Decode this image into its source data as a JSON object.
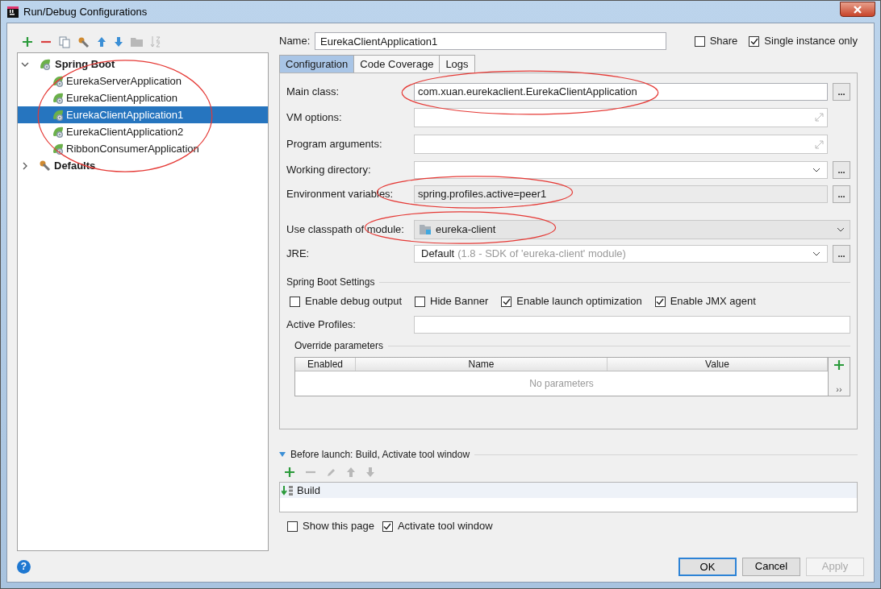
{
  "window": {
    "title": "Run/Debug Configurations"
  },
  "toolbar": [
    {
      "kind": "add",
      "disabled": false
    },
    {
      "kind": "remove",
      "disabled": false
    },
    {
      "kind": "copy",
      "disabled": false
    },
    {
      "kind": "wrench",
      "disabled": false
    },
    {
      "kind": "up",
      "disabled": false
    },
    {
      "kind": "down",
      "disabled": false
    },
    {
      "kind": "folder",
      "disabled": true
    },
    {
      "kind": "sort",
      "disabled": true
    }
  ],
  "tree": {
    "circled": true,
    "items": [
      {
        "label": "Spring Boot",
        "kind": "group",
        "expanded": true,
        "selected": false,
        "children": [
          {
            "label": "EurekaServerApplication",
            "kind": "config",
            "selected": false
          },
          {
            "label": "EurekaClientApplication",
            "kind": "config",
            "selected": false
          },
          {
            "label": "EurekaClientApplication1",
            "kind": "config",
            "selected": true
          },
          {
            "label": "EurekaClientApplication2",
            "kind": "config",
            "selected": false
          },
          {
            "label": "RibbonConsumerApplication",
            "kind": "config",
            "selected": false
          }
        ]
      },
      {
        "label": "Defaults",
        "kind": "defaults",
        "expanded": false,
        "selected": false
      }
    ]
  },
  "name": {
    "label": "Name:",
    "value": "EurekaClientApplication1"
  },
  "options": [
    {
      "label": "Share",
      "checked": false
    },
    {
      "label": "Single instance only",
      "checked": true
    }
  ],
  "tabs": [
    {
      "label": "Configuration",
      "selected": true
    },
    {
      "label": "Code Coverage",
      "selected": false
    },
    {
      "label": "Logs",
      "selected": false
    }
  ],
  "fields": [
    {
      "kind": "text",
      "label": "Main class:",
      "value": "com.xuan.eurekaclient.EurekaClientApplication",
      "browse": "...",
      "circled": true,
      "readonly": false
    },
    {
      "kind": "expand",
      "label": "VM options:"
    },
    {
      "kind": "expand",
      "label": "Program arguments:"
    },
    {
      "kind": "combo",
      "label": "Working directory:",
      "browse": "..."
    },
    {
      "kind": "text",
      "label": "Environment variables:",
      "value": "spring.profiles.active=peer1",
      "browse": "...",
      "circled": true,
      "readonly": true
    },
    {
      "kind": "module",
      "label": "Use classpath of module:",
      "value": "eureka-client",
      "circled": true
    },
    {
      "kind": "jre",
      "label": "JRE:",
      "value": "Default",
      "hint": "(1.8 - SDK of 'eureka-client' module)",
      "browse": "..."
    }
  ],
  "spring_boot_settings": {
    "title": "Spring Boot Settings",
    "checkboxes": [
      {
        "label": "Enable debug output",
        "checked": false
      },
      {
        "label": "Hide Banner",
        "checked": false
      },
      {
        "label": "Enable launch optimization",
        "checked": true
      },
      {
        "label": "Enable JMX agent",
        "checked": true
      }
    ],
    "active_profiles": {
      "label": "Active Profiles:"
    }
  },
  "override_parameters": {
    "title": "Override parameters",
    "columns": [
      "Enabled",
      "Name",
      "Value"
    ],
    "empty_text": "No parameters",
    "more": "››"
  },
  "before_launch": {
    "title": "Before launch: Build, Activate tool window",
    "expanded": true,
    "toolbar": [
      {
        "kind": "add",
        "disabled": false
      },
      {
        "kind": "remove",
        "disabled": true
      },
      {
        "kind": "edit",
        "disabled": true
      },
      {
        "kind": "up",
        "disabled": true
      },
      {
        "kind": "down",
        "disabled": true
      }
    ],
    "tasks": [
      {
        "label": "Build",
        "selected": true
      }
    ],
    "checkboxes": [
      {
        "label": "Show this page",
        "checked": false
      },
      {
        "label": "Activate tool window",
        "checked": true
      }
    ]
  },
  "help": "?",
  "buttons": [
    {
      "label": "OK",
      "kind": "default"
    },
    {
      "label": "Cancel",
      "kind": "normal"
    },
    {
      "label": "Apply",
      "kind": "disabled"
    }
  ]
}
